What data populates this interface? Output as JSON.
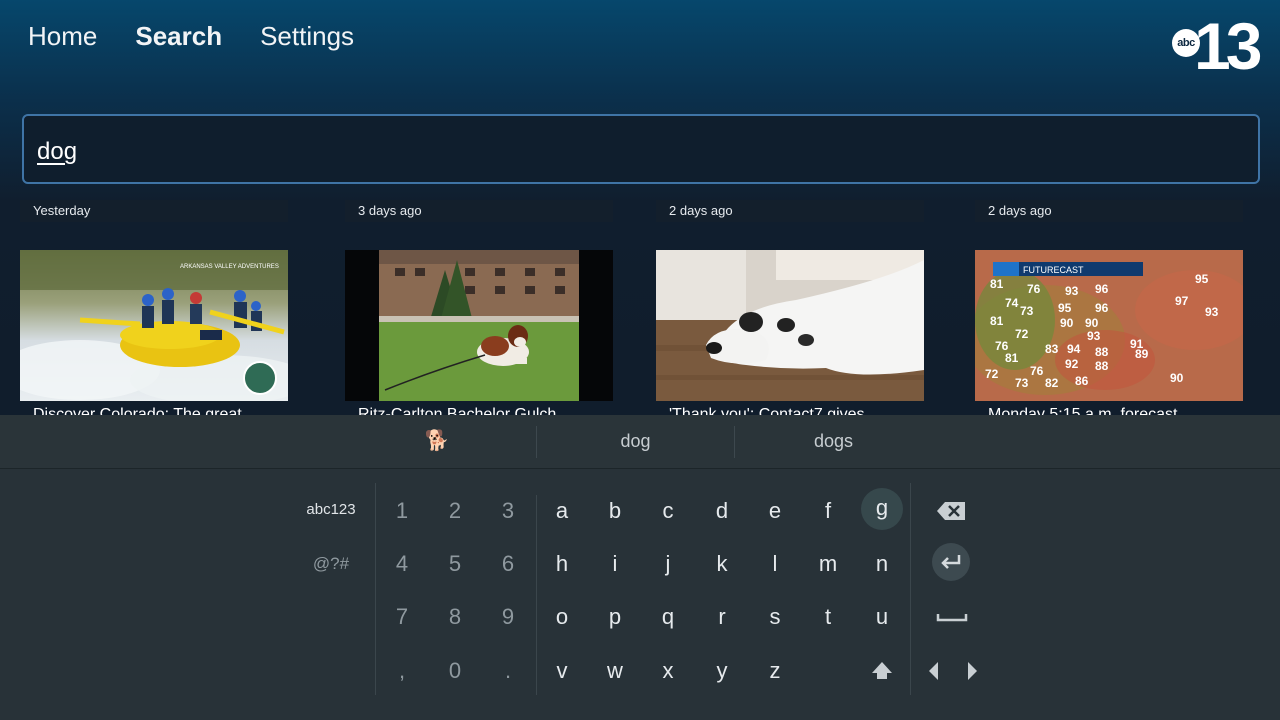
{
  "nav": {
    "items": [
      "Home",
      "Search",
      "Settings"
    ],
    "active": "Search"
  },
  "logo": {
    "abc": "abc",
    "number": "13"
  },
  "search": {
    "value": "dog"
  },
  "results": [
    {
      "time": "Yesterday",
      "title": "Discover Colorado: The great",
      "thumb_watermark": "ARKANSAS VALLEY ADVENTURES"
    },
    {
      "time": "3 days ago",
      "title": "Ritz-Carlton Bachelor Gulch",
      "thumb_watermark": ""
    },
    {
      "time": "2 days ago",
      "title": "'Thank you': Contact7 gives",
      "thumb_watermark": ""
    },
    {
      "time": "2 days ago",
      "title": "Monday 5:15 a.m. forecast",
      "thumb_watermark": "FUTURECAST"
    }
  ],
  "keyboard": {
    "suggestions": [
      "🐕",
      "dog",
      "dogs"
    ],
    "mode_keys": [
      "abc123",
      "@?#"
    ],
    "numbers": [
      "1",
      "2",
      "3",
      "4",
      "5",
      "6",
      "7",
      "8",
      "9",
      ",",
      "0",
      "."
    ],
    "letters": [
      "a",
      "b",
      "c",
      "d",
      "e",
      "f",
      "g",
      "h",
      "i",
      "j",
      "k",
      "l",
      "m",
      "n",
      "o",
      "p",
      "q",
      "r",
      "s",
      "t",
      "u",
      "v",
      "w",
      "x",
      "y",
      "z"
    ],
    "focused_key": "g",
    "icons": [
      "backspace-icon",
      "enter-icon",
      "space-icon",
      "shift-icon",
      "cursor-left-icon",
      "cursor-right-icon"
    ]
  },
  "colors": {
    "accent_border": "#3f74a6",
    "keyboard_bg": "#283238",
    "focus_key_bg": "#36484c"
  }
}
